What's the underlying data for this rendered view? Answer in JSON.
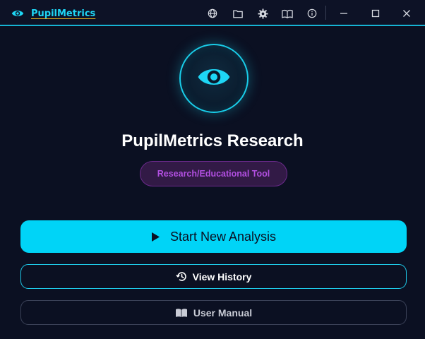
{
  "window": {
    "app_title": "PupilMetrics",
    "toolbar_icons": [
      "globe-icon",
      "folder-icon",
      "gear-icon",
      "book-icon",
      "info-icon"
    ],
    "controls": [
      "minimize-icon",
      "maximize-icon",
      "close-icon"
    ]
  },
  "hero": {
    "logo_icon": "eye-icon",
    "title": "PupilMetrics Research",
    "badge": "Research/Educational Tool"
  },
  "actions": {
    "start_label": "Start New Analysis",
    "start_icon": "play-icon",
    "history_label": "View History",
    "history_icon": "history-icon",
    "manual_label": "User Manual",
    "manual_icon": "book-icon"
  },
  "colors": {
    "background": "#0b1022",
    "accent": "#00d4f7",
    "badge_text": "#b14fe0",
    "badge_bg": "#321a46"
  }
}
